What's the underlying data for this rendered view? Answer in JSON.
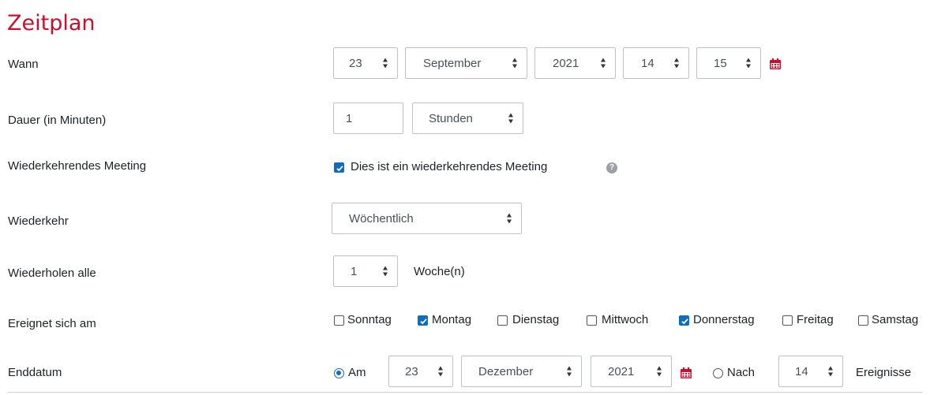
{
  "section": {
    "title": "Zeitplan"
  },
  "colors": {
    "title": "#c8102e",
    "accent": "#0f6cbf"
  },
  "wann": {
    "label": "Wann",
    "day": "23",
    "month": "September",
    "year": "2021",
    "hour": "14",
    "minute": "15",
    "calendar_icon": "calendar-icon"
  },
  "dauer": {
    "label": "Dauer (in Minuten)",
    "value": "1",
    "unit": "Stunden"
  },
  "wiederkehrend": {
    "label": "Wiederkehrendes Meeting",
    "checkbox_label": "Dies ist ein wiederkehrendes Meeting",
    "checked": true,
    "help_icon": "help-icon"
  },
  "wiederkehr": {
    "label": "Wiederkehr",
    "value": "Wöchentlich"
  },
  "wiederholen": {
    "label": "Wiederholen alle",
    "value": "1",
    "unit": "Woche(n)"
  },
  "ereignet": {
    "label": "Ereignet sich am",
    "days": [
      {
        "name": "Sonntag",
        "checked": false
      },
      {
        "name": "Montag",
        "checked": true
      },
      {
        "name": "Dienstag",
        "checked": false
      },
      {
        "name": "Mittwoch",
        "checked": false
      },
      {
        "name": "Donnerstag",
        "checked": true
      },
      {
        "name": "Freitag",
        "checked": false
      },
      {
        "name": "Samstag",
        "checked": false
      }
    ]
  },
  "enddatum": {
    "label": "Enddatum",
    "am_label": "Am",
    "am_selected": true,
    "day": "23",
    "month": "Dezember",
    "year": "2021",
    "nach_label": "Nach",
    "count": "14",
    "count_unit": "Ereignisse"
  }
}
